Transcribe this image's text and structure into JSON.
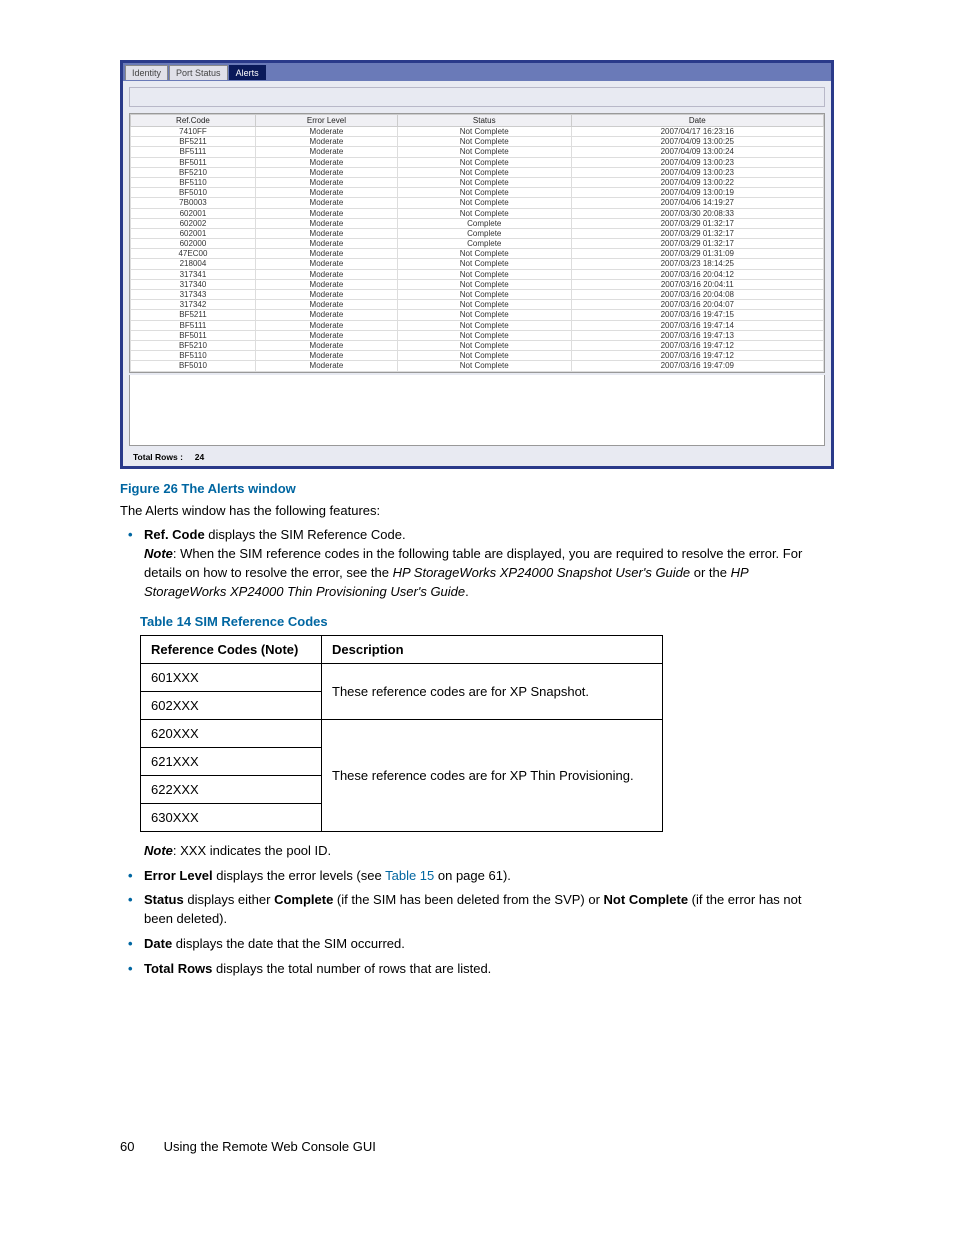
{
  "screenshot": {
    "tabs": [
      "Identity",
      "Port Status",
      "Alerts"
    ],
    "activeTabIndex": 2,
    "columns": [
      "Ref.Code",
      "Error Level",
      "Status",
      "Date"
    ],
    "rows": [
      {
        "code": "7410FF",
        "level": "Moderate",
        "status": "Not Complete",
        "date": "2007/04/17 16:23:16"
      },
      {
        "code": "BF5211",
        "level": "Moderate",
        "status": "Not Complete",
        "date": "2007/04/09 13:00:25"
      },
      {
        "code": "BF5111",
        "level": "Moderate",
        "status": "Not Complete",
        "date": "2007/04/09 13:00:24"
      },
      {
        "code": "BF5011",
        "level": "Moderate",
        "status": "Not Complete",
        "date": "2007/04/09 13:00:23"
      },
      {
        "code": "BF5210",
        "level": "Moderate",
        "status": "Not Complete",
        "date": "2007/04/09 13:00:23"
      },
      {
        "code": "BF5110",
        "level": "Moderate",
        "status": "Not Complete",
        "date": "2007/04/09 13:00:22"
      },
      {
        "code": "BF5010",
        "level": "Moderate",
        "status": "Not Complete",
        "date": "2007/04/09 13:00:19"
      },
      {
        "code": "7B0003",
        "level": "Moderate",
        "status": "Not Complete",
        "date": "2007/04/06 14:19:27"
      },
      {
        "code": "602001",
        "level": "Moderate",
        "status": "Not Complete",
        "date": "2007/03/30 20:08:33"
      },
      {
        "code": "602002",
        "level": "Moderate",
        "status": "Complete",
        "date": "2007/03/29 01:32:17"
      },
      {
        "code": "602001",
        "level": "Moderate",
        "status": "Complete",
        "date": "2007/03/29 01:32:17"
      },
      {
        "code": "602000",
        "level": "Moderate",
        "status": "Complete",
        "date": "2007/03/29 01:32:17"
      },
      {
        "code": "47EC00",
        "level": "Moderate",
        "status": "Not Complete",
        "date": "2007/03/29 01:31:09"
      },
      {
        "code": "218004",
        "level": "Moderate",
        "status": "Not Complete",
        "date": "2007/03/23 18:14:25"
      },
      {
        "code": "317341",
        "level": "Moderate",
        "status": "Not Complete",
        "date": "2007/03/16 20:04:12"
      },
      {
        "code": "317340",
        "level": "Moderate",
        "status": "Not Complete",
        "date": "2007/03/16 20:04:11"
      },
      {
        "code": "317343",
        "level": "Moderate",
        "status": "Not Complete",
        "date": "2007/03/16 20:04:08"
      },
      {
        "code": "317342",
        "level": "Moderate",
        "status": "Not Complete",
        "date": "2007/03/16 20:04:07"
      },
      {
        "code": "BF5211",
        "level": "Moderate",
        "status": "Not Complete",
        "date": "2007/03/16 19:47:15"
      },
      {
        "code": "BF5111",
        "level": "Moderate",
        "status": "Not Complete",
        "date": "2007/03/16 19:47:14"
      },
      {
        "code": "BF5011",
        "level": "Moderate",
        "status": "Not Complete",
        "date": "2007/03/16 19:47:13"
      },
      {
        "code": "BF5210",
        "level": "Moderate",
        "status": "Not Complete",
        "date": "2007/03/16 19:47:12"
      },
      {
        "code": "BF5110",
        "level": "Moderate",
        "status": "Not Complete",
        "date": "2007/03/16 19:47:12"
      },
      {
        "code": "BF5010",
        "level": "Moderate",
        "status": "Not Complete",
        "date": "2007/03/16 19:47:09"
      }
    ],
    "totalLabel": "Total Rows :",
    "totalValue": "24"
  },
  "figCaption": "Figure 26 The Alerts window",
  "intro": "The Alerts window has the following features:",
  "bullet1": {
    "lead": "Ref. Code",
    "text": " displays the SIM Reference Code.",
    "noteLead": "Note",
    "noteText": ": When the SIM reference codes in the following table are displayed, you are required to resolve the error. For details on how to resolve the error, see the ",
    "doc1": "HP StorageWorks XP24000 Snapshot User's Guide",
    "mid": " or the ",
    "doc2": "HP StorageWorks XP24000 Thin Provisioning User's Guide",
    "end": "."
  },
  "tableCaption": "Table 14 SIM Reference Codes",
  "refTable": {
    "h1": "Reference Codes (Note)",
    "h2": "Description",
    "codes1": [
      "601XXX",
      "602XXX"
    ],
    "desc1": "These reference codes are for XP Snapshot.",
    "codes2": [
      "620XXX",
      "621XXX",
      "622XXX",
      "630XXX"
    ],
    "desc2": "These reference codes are for XP Thin Provisioning."
  },
  "note2Lead": "Note",
  "note2Text": ": XXX indicates the pool ID.",
  "bullet2": {
    "lead": "Error Level",
    "text1": " displays the error levels (see ",
    "link": "Table 15",
    "text2": " on page 61)."
  },
  "bullet3": {
    "lead": "Status",
    "t1": " displays either ",
    "b1": "Complete",
    "t2": " (if the SIM has been deleted from the SVP) or ",
    "b2": "Not Complete",
    "t3": " (if the error has not been deleted)."
  },
  "bullet4": {
    "lead": "Date",
    "text": " displays the date that the SIM occurred."
  },
  "bullet5": {
    "lead": "Total Rows",
    "text": " displays the total number of rows that are listed."
  },
  "footer": {
    "page": "60",
    "title": "Using the Remote Web Console GUI"
  }
}
